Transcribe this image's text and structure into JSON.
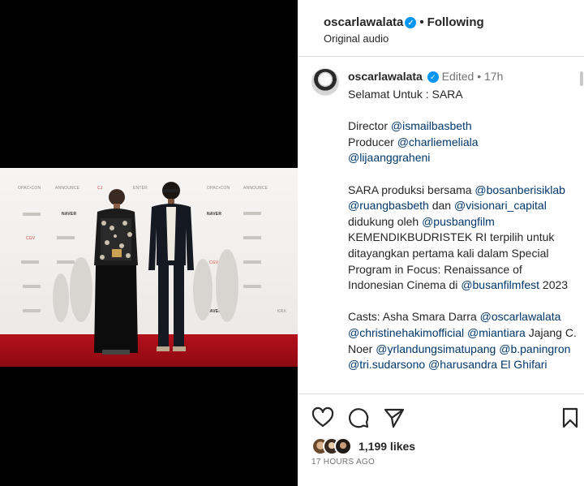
{
  "header": {
    "username": "oscarlawalata",
    "follow_status": "Following",
    "audio": "Original audio",
    "dot": "•"
  },
  "caption": {
    "username": "oscarlawalata",
    "edited": "Edited",
    "dot": "•",
    "time": "17h",
    "line1": "Selamat Untuk : SARA",
    "director_label": "Director",
    "director": "@ismailbasbeth",
    "producer_label": "Producer",
    "producer": "@charliemeliala",
    "producer2": "@lijaanggraheni",
    "p3_a": "SARA produksi bersama",
    "m_bosan": "@bosanberisiklab",
    "m_ruang": "@ruangbasbeth",
    "p3_dan": "dan",
    "m_visionari": "@visionari_capital",
    "p3_didukung": "didukung oleh",
    "m_pusbang": "@pusbangfilm",
    "p3_b": "KEMENDIKBUDRISTEK RI terpilih untuk ditayangkan pertama kali dalam Special Program in Focus: Renaissance of Indonesian Cinema di",
    "m_busan": "@busanfilmfest",
    "p3_year": "2023",
    "casts_label": "Casts: Asha Smara Darra",
    "c_oscar": "@oscarlawalata",
    "c_christine": "@christinehakimofficial",
    "c_mian": "@miantiara",
    "c_jajang": "Jajang C. Noer",
    "c_yrland": "@yrlandungsimatupang",
    "c_pan": "@b.paningron",
    "c_tail": "@tri.sudarsono @harusandra El Ghifari"
  },
  "stats": {
    "likes": "1,199 likes",
    "time_ago": "17 HOURS AGO"
  },
  "backdrop_logos": {
    "l1": "OPAC•CON",
    "l2": "ANNOUNCE",
    "l3": "CJ",
    "l4": "ENTER",
    "l5": "OPAC•CON",
    "l6": "ANNOUNCE",
    "l7": "NAVER",
    "l8": "CGV",
    "l9": "NAVER",
    "l10": "CGV",
    "l11": "KRX",
    "l12": "NAVER"
  },
  "colors": {
    "accent_blue": "#0095f6",
    "mention": "#00376b",
    "carpet": "#b3111b"
  }
}
